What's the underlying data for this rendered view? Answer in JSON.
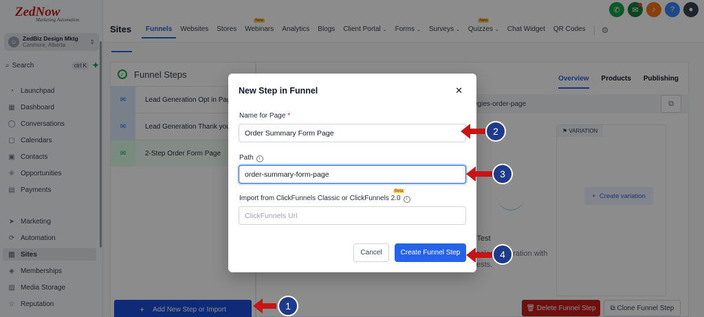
{
  "brand": {
    "name": "ZedNow",
    "tagline": "Marketing Automation"
  },
  "account": {
    "initial": "☺",
    "name": "ZedBiz Design Mktg",
    "location": "Canmore, Alberta"
  },
  "search": {
    "label": "Search",
    "shortcut": "ctrl K"
  },
  "sidebar": {
    "items": [
      {
        "label": "Launchpad",
        "icon": "rocket-icon"
      },
      {
        "label": "Dashboard",
        "icon": "grid-icon"
      },
      {
        "label": "Conversations",
        "icon": "chat-icon"
      },
      {
        "label": "Calendars",
        "icon": "calendar-icon"
      },
      {
        "label": "Contacts",
        "icon": "contacts-icon"
      },
      {
        "label": "Opportunities",
        "icon": "opportunities-icon"
      },
      {
        "label": "Payments",
        "icon": "payments-icon"
      },
      {
        "label": "Marketing",
        "icon": "send-icon"
      },
      {
        "label": "Automation",
        "icon": "automation-icon"
      },
      {
        "label": "Sites",
        "icon": "sites-icon"
      },
      {
        "label": "Memberships",
        "icon": "memberships-icon"
      },
      {
        "label": "Media Storage",
        "icon": "media-icon"
      },
      {
        "label": "Reputation",
        "icon": "star-icon"
      }
    ]
  },
  "header": {
    "title": "Sites",
    "tabs": [
      {
        "label": "Funnels"
      },
      {
        "label": "Websites"
      },
      {
        "label": "Stores"
      },
      {
        "label": "Webinars",
        "badge": "New"
      },
      {
        "label": "Analytics"
      },
      {
        "label": "Blogs"
      },
      {
        "label": "Client Portal"
      },
      {
        "label": "Forms"
      },
      {
        "label": "Surveys"
      },
      {
        "label": "Quizzes",
        "badge": "New"
      },
      {
        "label": "Chat Widget"
      },
      {
        "label": "QR Codes"
      }
    ]
  },
  "funnel": {
    "title": "Funnel Steps",
    "steps": [
      {
        "label": "Lead Generation Opt in Page"
      },
      {
        "label": "Lead Generation Thank you I"
      },
      {
        "label": "2-Step Order Form Page"
      }
    ],
    "add_button": "Add New Step or Import"
  },
  "right_panel": {
    "tabs": [
      "Overview",
      "Products",
      "Publishing"
    ],
    "url": "egies-order-page",
    "variation_tag": "VARIATION",
    "create_variation": "Create variation",
    "split_title": "it Test",
    "split_desc_1": "sales generation with",
    "split_desc_2": "ests."
  },
  "actions": {
    "delete": "Delete Funnel Step",
    "clone": "Clone Funnel Step"
  },
  "modal": {
    "title": "New Step in Funnel",
    "name_label": "Name for Page",
    "name_value": "Order Summary Form Page",
    "path_label": "Path",
    "path_value": "order-summary-form-page",
    "import_label": "Import from ClickFunnels Classic or ClickFunnels 2.0",
    "import_badge": "Beta",
    "import_placeholder": "ClickFunnels Url",
    "cancel": "Cancel",
    "create": "Create Funnel Step"
  },
  "annotations": [
    "1",
    "2",
    "3",
    "4"
  ],
  "colors": {
    "accent": "#2563eb",
    "danger": "#c81e1e",
    "annotation": "#c81414",
    "annotation_badge": "#1e3a8a"
  }
}
